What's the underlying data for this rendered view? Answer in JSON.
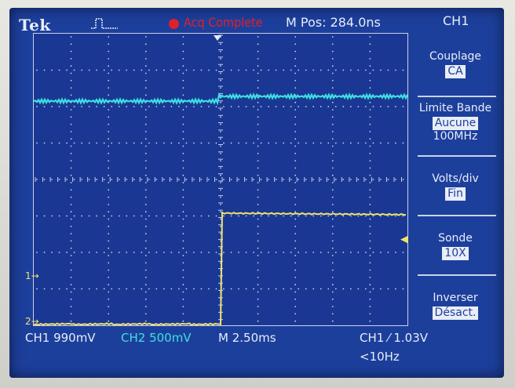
{
  "header": {
    "brand": "Tek",
    "acq_status": "Acq Complete",
    "position": "M Pos: 284.0ns",
    "channel": "CH1"
  },
  "plot": {
    "ch1_marker": "1→",
    "ch2_marker": "2→",
    "trigger_level_marker": "◀"
  },
  "menu": {
    "couplage": {
      "label": "Couplage",
      "value": "CA"
    },
    "limite_bande": {
      "label": "Limite Bande",
      "value": "Aucune",
      "secondary": "100MHz"
    },
    "volts_div": {
      "label": "Volts/div",
      "value": "Fin"
    },
    "sonde": {
      "label": "Sonde",
      "value": "10X"
    },
    "inverser": {
      "label": "Inverser",
      "value": "Désact."
    }
  },
  "status": {
    "ch1": "CH1  990mV",
    "ch2": "CH2  500mV",
    "timebase": "M 2.50ms",
    "trigger": "CH1 ⁄ 1.03V",
    "freq": "<10Hz"
  },
  "colors": {
    "ch1": "#f2e36b",
    "ch2": "#3ee0e0",
    "background": "#1d3f9c",
    "acq_red": "#e0202a"
  }
}
